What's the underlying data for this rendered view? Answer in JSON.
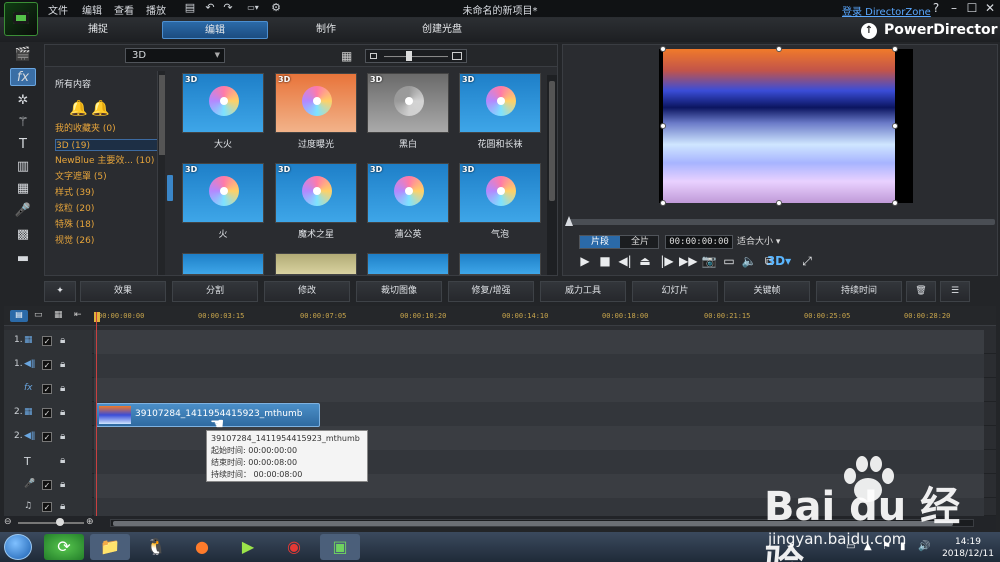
{
  "titlebar": {
    "menus": [
      "文件",
      "编辑",
      "查看",
      "播放"
    ],
    "title": "未命名的新项目*",
    "login": "登录 DirectorZone",
    "help": "?",
    "minimize": "–",
    "maximize": "☐",
    "close": "✕"
  },
  "modules": {
    "tabs": [
      "捕捉",
      "编辑",
      "制作",
      "创建光盘"
    ],
    "brand": "PowerDirector",
    "brand_icon": "↑"
  },
  "library": {
    "combo": "3D",
    "category_title": "所有内容",
    "categories": [
      {
        "label": "我的收藏夹  (0)"
      },
      {
        "label": "3D  (19)"
      },
      {
        "label": "NewBlue 主要效...  (10)"
      },
      {
        "label": "文字遮罩  (5)"
      },
      {
        "label": "样式  (39)"
      },
      {
        "label": "炫粒  (20)"
      },
      {
        "label": "特殊  (18)"
      },
      {
        "label": "视觉  (26)"
      }
    ],
    "effects": [
      {
        "badge": "3D",
        "label": "大火"
      },
      {
        "badge": "3D",
        "label": "过度曝光"
      },
      {
        "badge": "3D",
        "label": "黑白"
      },
      {
        "badge": "3D",
        "label": "花圆和长袜"
      },
      {
        "badge": "3D",
        "label": "火"
      },
      {
        "badge": "3D",
        "label": "魔术之星"
      },
      {
        "badge": "3D",
        "label": "蒲公英"
      },
      {
        "badge": "3D",
        "label": "气泡"
      }
    ]
  },
  "preview": {
    "clip_btn": "片段",
    "full_btn": "全片",
    "timecode": "00:00:00:00",
    "fit": "适合大小",
    "mode_3d": "3D"
  },
  "edit_toolbar": [
    "效果",
    "分割",
    "修改",
    "裁切图像",
    "修复/增强",
    "威力工具",
    "幻灯片",
    "关键帧",
    "持续时间"
  ],
  "timeline": {
    "ticks": [
      "00:00:00:00",
      "00:00:03:15",
      "00:00:07:05",
      "00:00:10:20",
      "00:00:14:10",
      "00:00:18:00",
      "00:00:21:15",
      "00:00:25:05",
      "00:00:28:20"
    ],
    "tracks": [
      {
        "name": "1."
      },
      {
        "name": "1."
      },
      {
        "name": "fx"
      },
      {
        "name": "2."
      },
      {
        "name": "2."
      },
      {
        "name": "T"
      },
      {
        "name": "🎤"
      },
      {
        "name": "♫"
      }
    ],
    "clip": {
      "name": "39107284_1411954415923_mthumb"
    },
    "tooltip": {
      "title": "39107284_1411954415923_mthumb",
      "start": "起始时间:  00:00:00:00",
      "end": "结束时间:  00:00:08:00",
      "duration": "持续时间：  00:00:08:00"
    }
  },
  "taskbar": {
    "time": "14:19",
    "date": "2018/12/11"
  },
  "watermark": {
    "brand": "Bai  du 经验",
    "url": "jingyan.baidu.com"
  }
}
